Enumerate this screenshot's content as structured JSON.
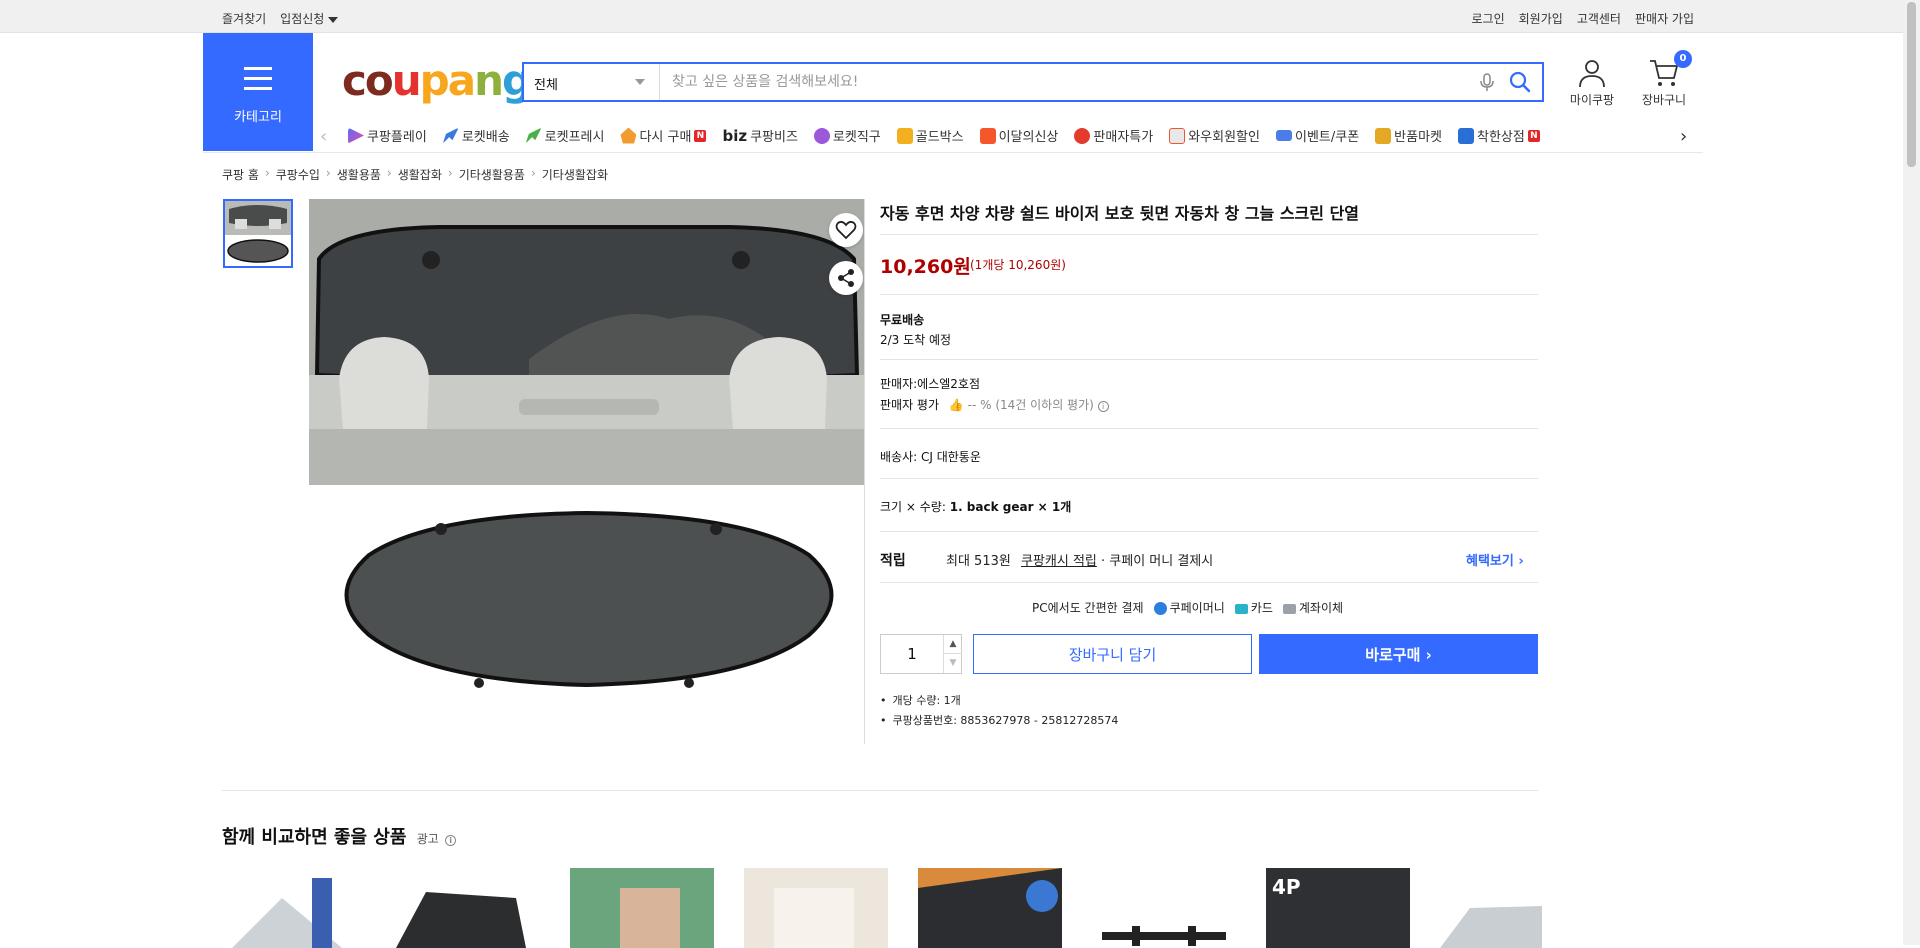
{
  "topbar": {
    "favorites": "즐겨찾기",
    "seller_apply": "입점신청",
    "login": "로그인",
    "signup": "회원가입",
    "customer_center": "고객센터",
    "seller_signup": "판매자 가입"
  },
  "header": {
    "category_label": "카테고리",
    "logo": {
      "p1": "co",
      "p2": "u",
      "p3": "pa",
      "p4": "n",
      "p5": "g"
    },
    "search": {
      "category": "전체",
      "placeholder": "찾고 싶은 상품을 검색해보세요!"
    },
    "mycoupang": "마이쿠팡",
    "cart": "장바구니",
    "cart_count": "0"
  },
  "nav": [
    "쿠팡플레이",
    "로켓배송",
    "로켓프레시",
    "다시 구매",
    "쿠팡비즈",
    "로켓직구",
    "골드박스",
    "이달의신상",
    "판매자특가",
    "와우회원할인",
    "이벤트/쿠폰",
    "반품마켓",
    "착한상점"
  ],
  "nav_biz_prefix": "biz",
  "breadcrumb": [
    "쿠팡 홈",
    "쿠팡수입",
    "생활용품",
    "생활잡화",
    "기타생활용품",
    "기타생활잡화"
  ],
  "product": {
    "title": "자동 후면 차양 차량 쉴드 바이저 보호 뒷면 자동차 창 그늘 스크린 단열",
    "price": "10,260원",
    "unit_price": "(1개당 10,260원)",
    "shipping_label": "무료배송",
    "arrival": "2/3 도착 예정",
    "seller": "판매자:에스엘2호점",
    "seller_rating_label": "판매자 평가",
    "seller_rating_value": "-- % (14건 이하의 평가)",
    "carrier": "배송사:  CJ 대한통운",
    "option_label": "크기 × 수량:",
    "option_value": "1. back gear × 1개",
    "reward_label": "적립",
    "reward_max": "최대 513원",
    "reward_cash": "쿠팡캐시 적립",
    "reward_note": "· 쿠페이 머니 결제시",
    "benefit": "혜택보기",
    "pay_title": "PC에서도 간편한 결제",
    "pay_methods": [
      "쿠페이머니",
      "카드",
      "계좌이체"
    ],
    "quantity": "1",
    "cart_button": "장바구니 담기",
    "buy_button": "바로구매",
    "details": [
      "개당 수량: 1개",
      "쿠팡상품번호: 8853627978 - 25812728574"
    ]
  },
  "recommend": {
    "title": "함께 비교하면 좋을 상품",
    "ad": "광고"
  },
  "colors": {
    "accent": "#346aff",
    "price": "#ae0000"
  }
}
